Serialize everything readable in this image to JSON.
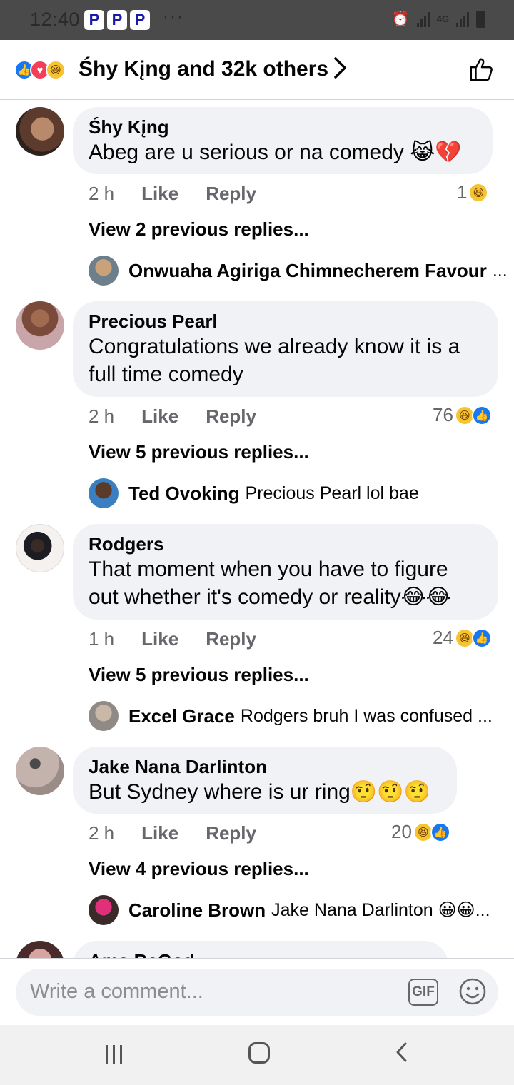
{
  "status_bar": {
    "time": "12:40",
    "app_icons": [
      "P",
      "P",
      "P"
    ],
    "more": "···",
    "network": "4G"
  },
  "header": {
    "likers": "Śhy Kįng and 32k others",
    "chevron": "›",
    "reaction_icons": [
      "like-icon",
      "love-icon",
      "haha-icon"
    ]
  },
  "comments": [
    {
      "name": "Śhy Kįng",
      "text": "Abeg are u serious or na comedy 😹💔",
      "time": "2 h",
      "like": "Like",
      "reply": "Reply",
      "reaction_count": "1",
      "view_prev": "View 2 previous replies...",
      "reply_author": "Onwuaha Agiriga Chimnecherem Favour",
      "reply_text": "..."
    },
    {
      "name": "Precious Pearl",
      "text": "Congratulations we already know it is a full time comedy",
      "time": "2 h",
      "like": "Like",
      "reply": "Reply",
      "reaction_count": "76",
      "view_prev": "View 5 previous replies...",
      "reply_author": "Ted Ovoking",
      "reply_text": "Precious Pearl lol bae"
    },
    {
      "name": "Rodgers",
      "text": "That moment when you have to figure out whether it's comedy or reality😂😂",
      "time": "1 h",
      "like": "Like",
      "reply": "Reply",
      "reaction_count": "24",
      "view_prev": "View 5 previous replies...",
      "reply_author": "Excel Grace",
      "reply_text": "Rodgers bruh I was confused ..."
    },
    {
      "name": "Jake Nana Darlinton",
      "text": "But Sydney where is ur ring🤨🤨🤨",
      "time": "2 h",
      "like": "Like",
      "reply": "Reply",
      "reaction_count": "20",
      "view_prev": "View 4 previous replies...",
      "reply_author": "Caroline Brown",
      "reply_text": "Jake Nana Darlinton 😀😀..."
    },
    {
      "name": "Ama BeGod"
    }
  ],
  "composer": {
    "placeholder": "Write a comment...",
    "gif_label": "GIF"
  },
  "colors": {
    "bubble": "#f0f2f5",
    "secondary_text": "#65676b",
    "like_blue": "#1877f2",
    "haha_yellow": "#f7c431"
  }
}
